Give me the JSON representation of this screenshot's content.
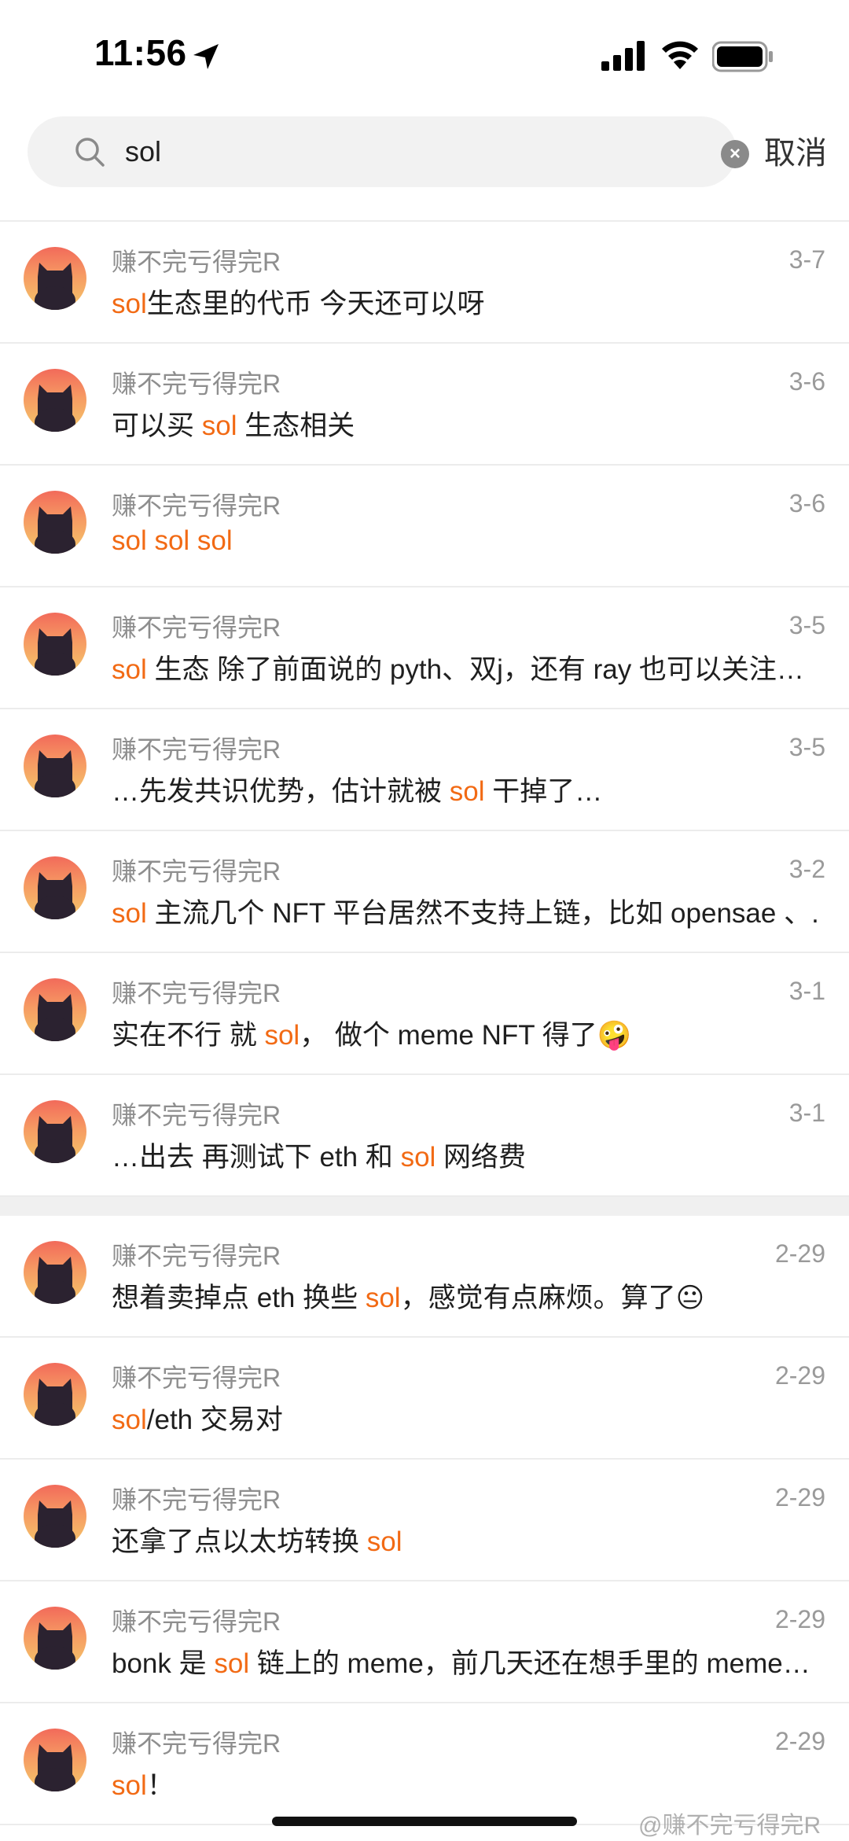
{
  "status_bar": {
    "time": "11:56"
  },
  "search": {
    "query": "sol",
    "cancel_label": "取消"
  },
  "results": [
    {
      "author": "赚不完亏得完R",
      "date": "3-7",
      "segments": [
        {
          "t": "sol",
          "hl": true
        },
        {
          "t": "生态里的代币 今天还可以呀",
          "hl": false
        }
      ]
    },
    {
      "author": "赚不完亏得完R",
      "date": "3-6",
      "segments": [
        {
          "t": "可以买 ",
          "hl": false
        },
        {
          "t": "sol",
          "hl": true
        },
        {
          "t": " 生态相关",
          "hl": false
        }
      ]
    },
    {
      "author": "赚不完亏得完R",
      "date": "3-6",
      "segments": [
        {
          "t": "sol sol sol",
          "hl": true
        }
      ]
    },
    {
      "author": "赚不完亏得完R",
      "date": "3-5",
      "segments": [
        {
          "t": "sol",
          "hl": true
        },
        {
          "t": " 生态 除了前面说的 pyth、双j，还有 ray 也可以关注…",
          "hl": false
        }
      ]
    },
    {
      "author": "赚不完亏得完R",
      "date": "3-5",
      "segments": [
        {
          "t": "…先发共识优势，估计就被 ",
          "hl": false
        },
        {
          "t": "sol",
          "hl": true
        },
        {
          "t": " 干掉了…",
          "hl": false
        }
      ]
    },
    {
      "author": "赚不完亏得完R",
      "date": "3-2",
      "segments": [
        {
          "t": "sol",
          "hl": true
        },
        {
          "t": " 主流几个 NFT 平台居然不支持上链，比如 opensae 、..",
          "hl": false
        }
      ]
    },
    {
      "author": "赚不完亏得完R",
      "date": "3-1",
      "segments": [
        {
          "t": "实在不行 就 ",
          "hl": false
        },
        {
          "t": "sol",
          "hl": true
        },
        {
          "t": "， 做个 meme NFT 得了🤪",
          "hl": false
        }
      ]
    },
    {
      "author": "赚不完亏得完R",
      "date": "3-1",
      "segments": [
        {
          "t": "…出去 再测试下 eth 和 ",
          "hl": false
        },
        {
          "t": "sol",
          "hl": true
        },
        {
          "t": " 网络费",
          "hl": false
        }
      ]
    },
    {
      "author": "赚不完亏得完R",
      "date": "2-29",
      "segments": [
        {
          "t": "想着卖掉点 eth 换些 ",
          "hl": false
        },
        {
          "t": "sol",
          "hl": true
        },
        {
          "t": "，感觉有点麻烦。算了😐",
          "hl": false
        }
      ]
    },
    {
      "author": "赚不完亏得完R",
      "date": "2-29",
      "segments": [
        {
          "t": "sol",
          "hl": true
        },
        {
          "t": "/eth 交易对",
          "hl": false
        }
      ]
    },
    {
      "author": "赚不完亏得完R",
      "date": "2-29",
      "segments": [
        {
          "t": "还拿了点以太坊转换 ",
          "hl": false
        },
        {
          "t": "sol",
          "hl": true
        }
      ]
    },
    {
      "author": "赚不完亏得完R",
      "date": "2-29",
      "segments": [
        {
          "t": "bonk 是 ",
          "hl": false
        },
        {
          "t": "sol",
          "hl": true
        },
        {
          "t": " 链上的 meme，前几天还在想手里的 meme…",
          "hl": false
        }
      ]
    },
    {
      "author": "赚不完亏得完R",
      "date": "2-29",
      "segments": [
        {
          "t": "sol",
          "hl": true
        },
        {
          "t": "！",
          "hl": false
        }
      ]
    }
  ],
  "watermark": "@赚不完亏得完R",
  "colors": {
    "highlight": "#f26a14",
    "muted_text": "#8e8e8e",
    "divider": "#ececec"
  }
}
